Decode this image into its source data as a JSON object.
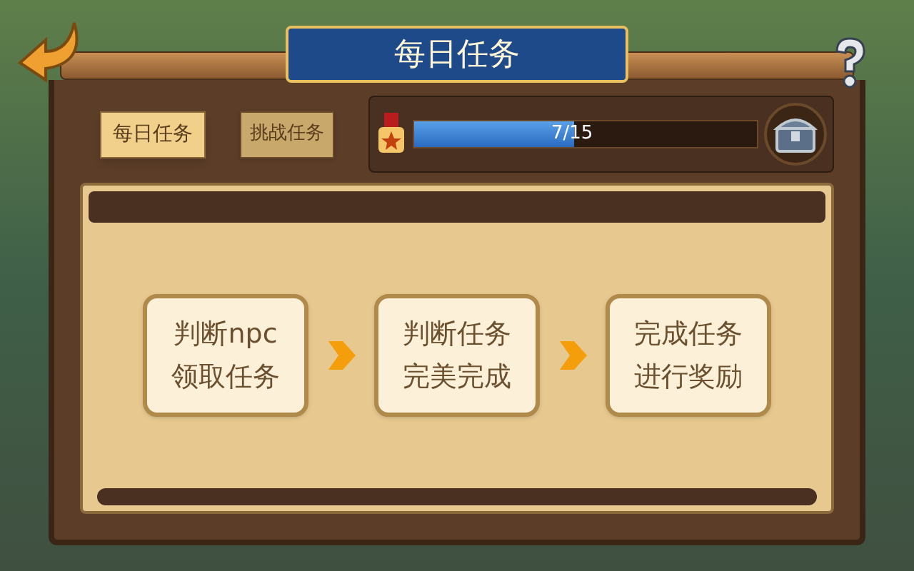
{
  "header": {
    "title": "每日任务"
  },
  "tabs": [
    {
      "label": "每日任务",
      "selected": true
    },
    {
      "label": "挑战任务",
      "selected": false
    }
  ],
  "progress": {
    "level": 0.4667,
    "reading": "7/15"
  },
  "steps": [
    {
      "lines": [
        "判断npc",
        "领取任务"
      ]
    },
    {
      "lines": [
        "判断任务",
        "完美完成"
      ]
    },
    {
      "lines": [
        "完成任务",
        "进行奖励"
      ]
    }
  ]
}
